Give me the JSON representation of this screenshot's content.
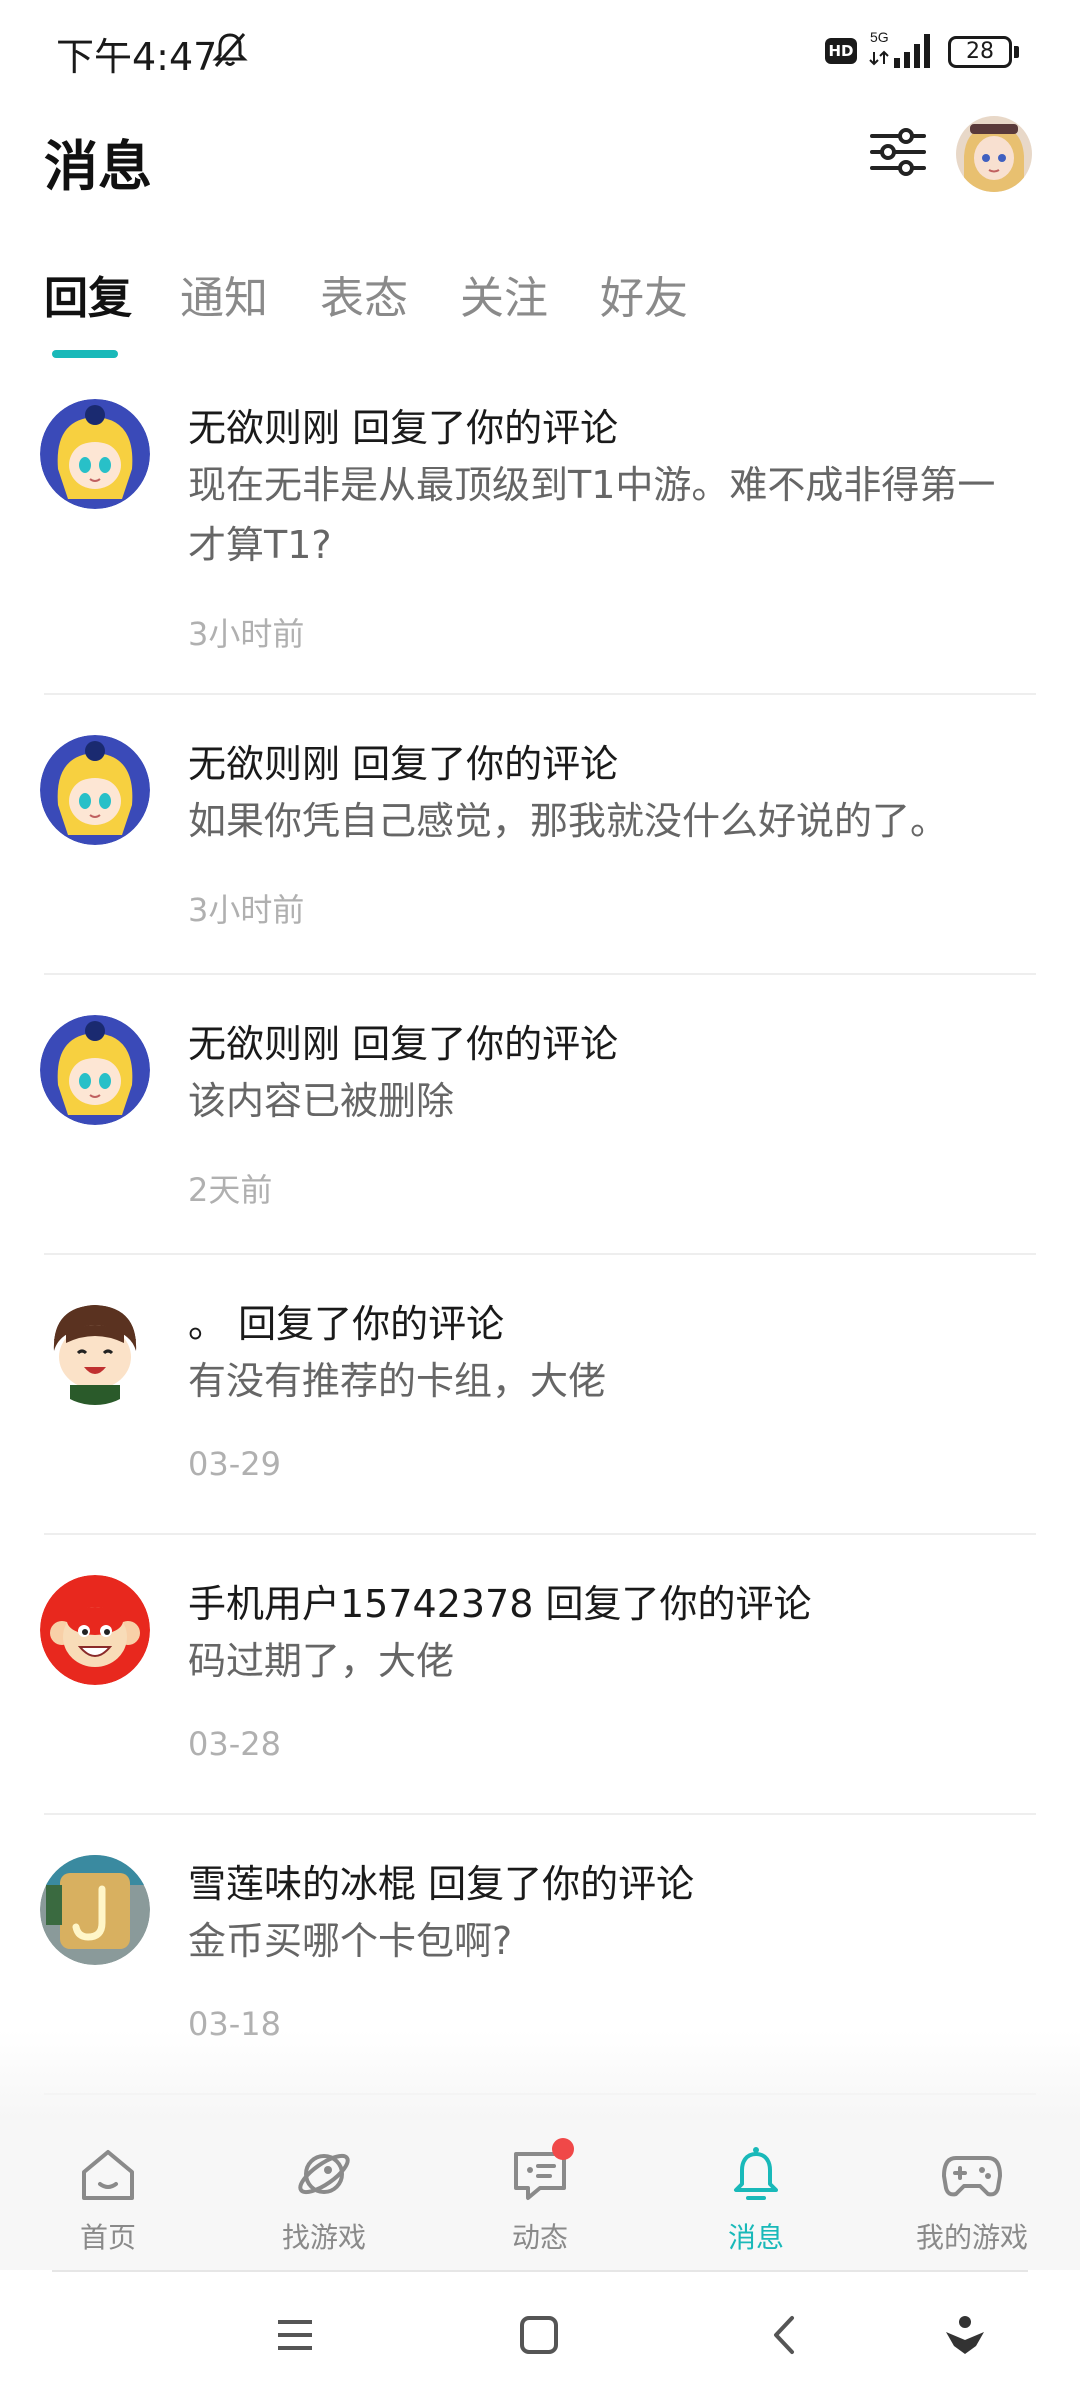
{
  "status_bar": {
    "time": "下午4:47",
    "network": "5G",
    "hd_label": "HD",
    "battery": "28"
  },
  "header": {
    "title": "消息"
  },
  "tabs": [
    {
      "label": "回复",
      "active": true
    },
    {
      "label": "通知",
      "active": false
    },
    {
      "label": "表态",
      "active": false
    },
    {
      "label": "关注",
      "active": false
    },
    {
      "label": "好友",
      "active": false
    }
  ],
  "messages": [
    {
      "title": "无欲则刚 回复了你的评论",
      "body": "现在无非是从最顶级到T1中游。难不成非得第一才算T1?",
      "time": "3小时前",
      "avatar": "anime-girl-avatar"
    },
    {
      "title": "无欲则刚 回复了你的评论",
      "body": "如果你凭自己感觉，那我就没什么好说的了。",
      "time": "3小时前",
      "avatar": "anime-girl-avatar"
    },
    {
      "title": "无欲则刚 回复了你的评论",
      "body": "该内容已被删除",
      "time": "2天前",
      "avatar": "anime-girl-avatar"
    },
    {
      "title": "。 回复了你的评论",
      "body": "有没有推荐的卡组，大佬",
      "time": "03-29",
      "avatar": "cartoon-boy-avatar"
    },
    {
      "title": "手机用户15742378 回复了你的评论",
      "body": "码过期了，大佬",
      "time": "03-28",
      "avatar": "monkey-avatar"
    },
    {
      "title": "雪莲味的冰棍 回复了你的评论",
      "body": "金币买哪个卡包啊?",
      "time": "03-18",
      "avatar": "neon-sign-avatar"
    }
  ],
  "bottom_nav": [
    {
      "label": "首页",
      "icon": "home-icon",
      "active": false
    },
    {
      "label": "找游戏",
      "icon": "planet-icon",
      "active": false
    },
    {
      "label": "动态",
      "icon": "chat-icon",
      "active": false,
      "badge": true
    },
    {
      "label": "消息",
      "icon": "bell-icon",
      "active": true
    },
    {
      "label": "我的游戏",
      "icon": "gamepad-icon",
      "active": false
    }
  ],
  "colors": {
    "accent": "#19b9b9",
    "badge": "#f04848",
    "text_primary": "#1a1a1a",
    "text_secondary": "#666666",
    "text_muted": "#b0b0b0"
  }
}
